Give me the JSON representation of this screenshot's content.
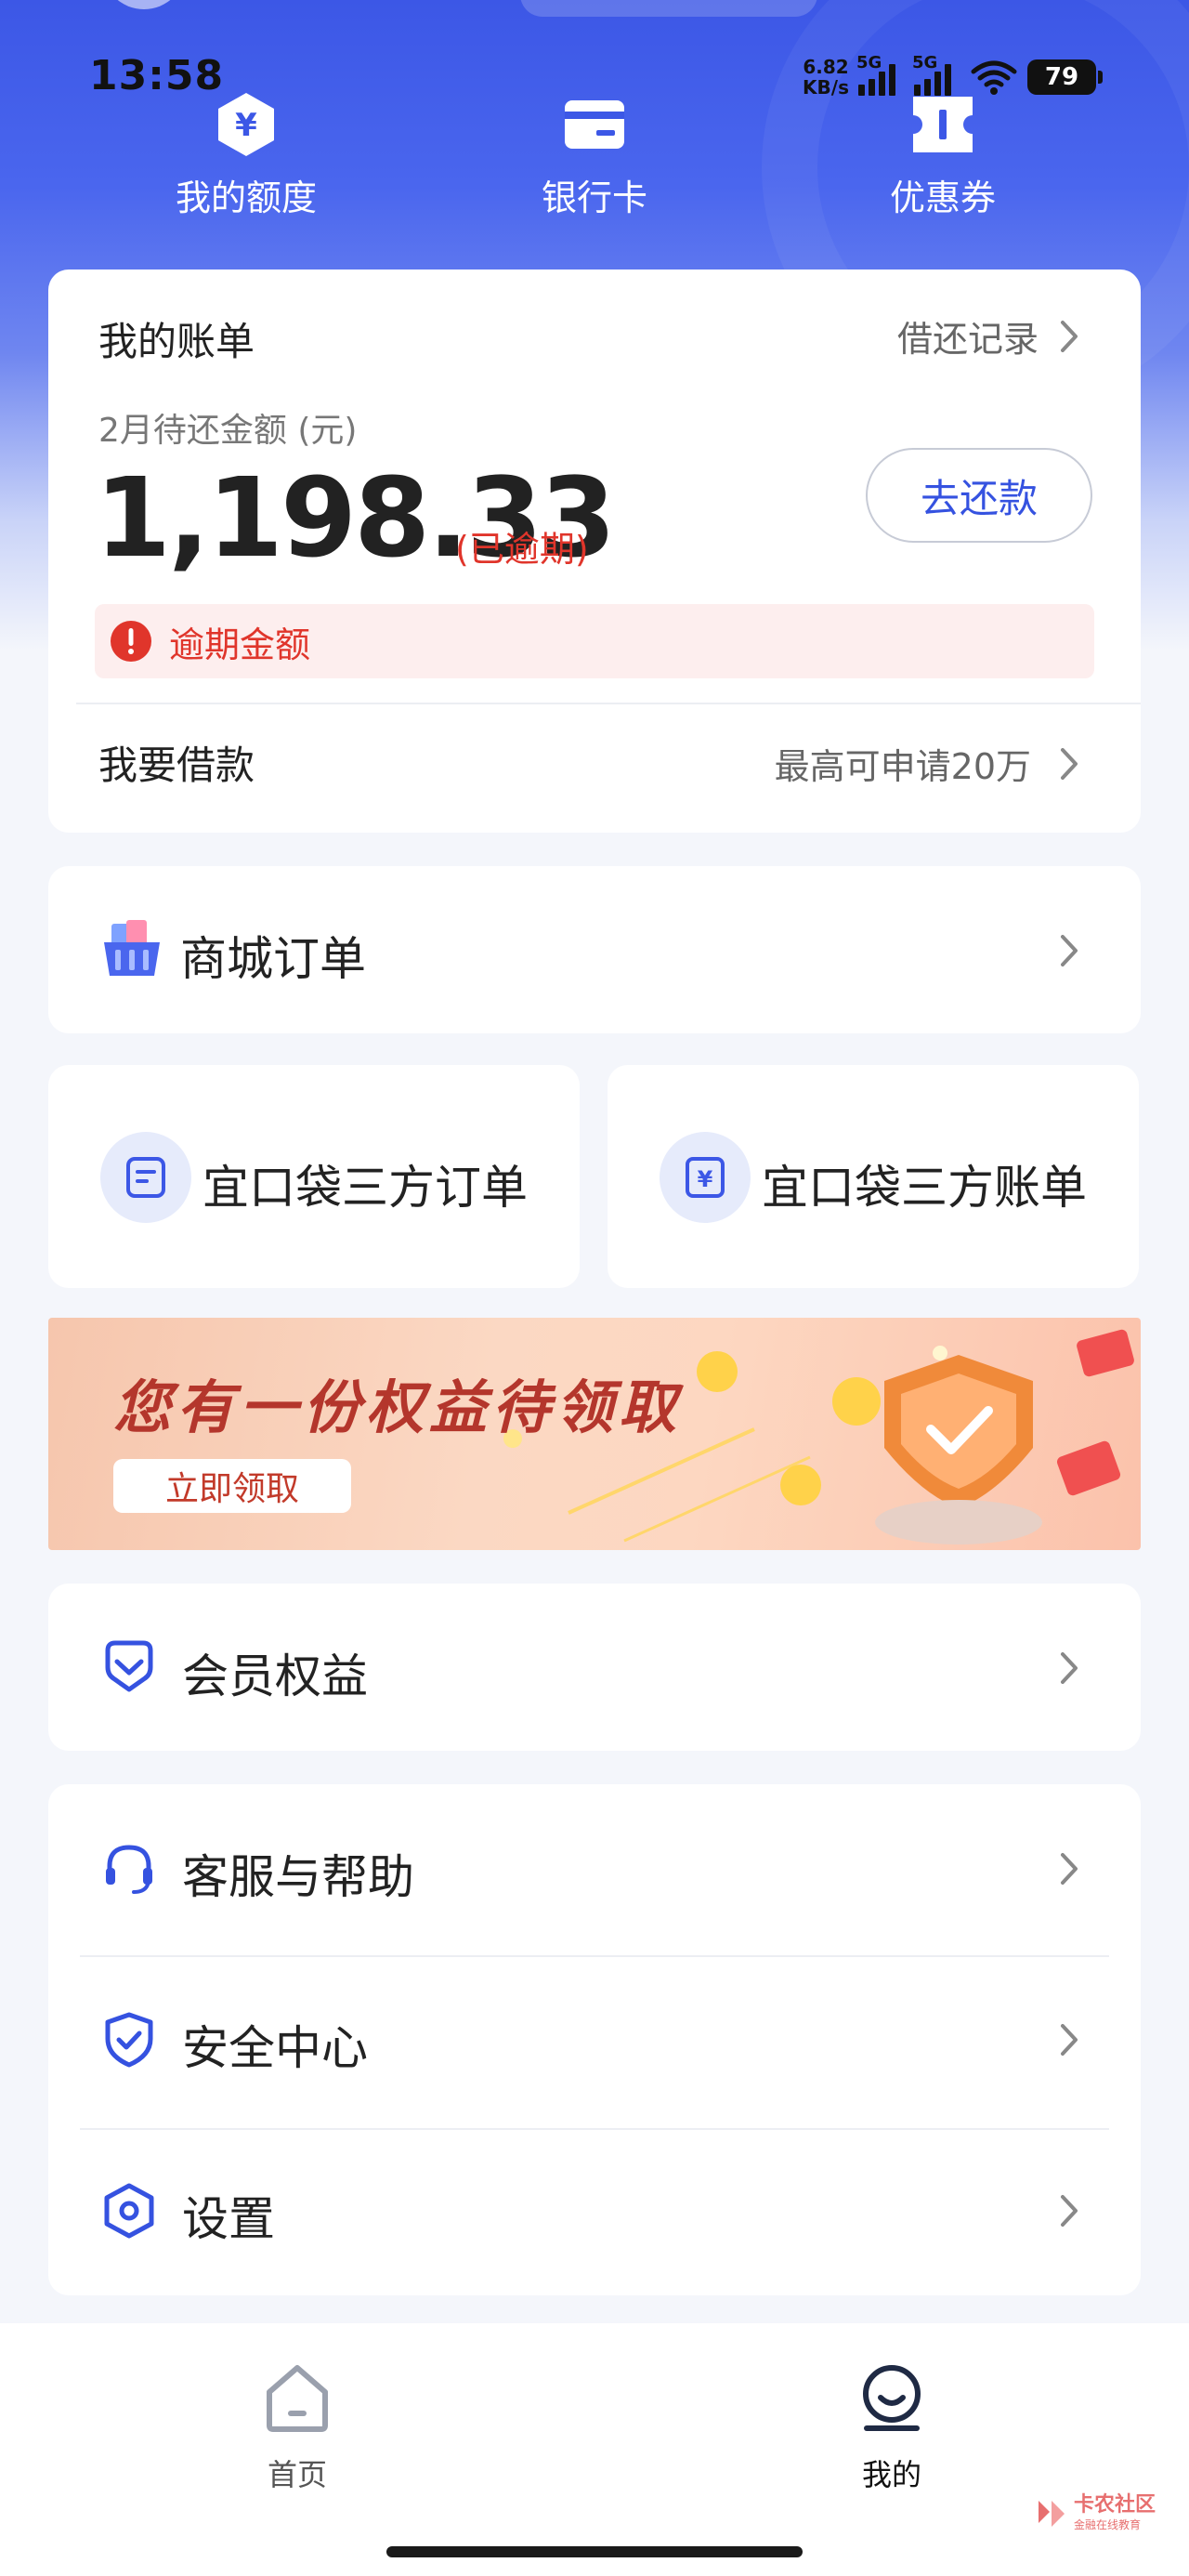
{
  "status_bar": {
    "time": "13:58",
    "net_speed_value": "6.82",
    "net_speed_unit": "KB/s",
    "sim1_tag": "5G",
    "sim2_tag": "5G",
    "battery": "79"
  },
  "quick_nav": [
    {
      "label": "我的额度",
      "icon": "yuan-hexagon-icon"
    },
    {
      "label": "银行卡",
      "icon": "bank-card-icon"
    },
    {
      "label": "优惠券",
      "icon": "coupon-icon"
    }
  ],
  "bill": {
    "title": "我的账单",
    "record_link": "借还记录",
    "subtitle": "2月待还金额 (元)",
    "amount": "1,198.33",
    "overdue_tag": "(已逾期)",
    "repay_button": "去还款",
    "overdue_notice": "逾期金额",
    "borrow_label": "我要借款",
    "borrow_hint": "最高可申请20万"
  },
  "mall_orders": {
    "label": "商城订单"
  },
  "third_party": [
    {
      "label": "宜口袋三方订单",
      "icon": "document-icon"
    },
    {
      "label": "宜口袋三方账单",
      "icon": "yuan-bill-icon"
    }
  ],
  "banner": {
    "title": "您有一份权益待领取",
    "button": "立即领取"
  },
  "member_benefits": {
    "label": "会员权益"
  },
  "service_list": [
    {
      "label": "客服与帮助",
      "icon": "headset-icon"
    },
    {
      "label": "安全中心",
      "icon": "shield-check-icon"
    },
    {
      "label": "设置",
      "icon": "settings-hexagon-icon"
    }
  ],
  "bottom_nav": [
    {
      "label": "首页",
      "icon": "home-icon",
      "active": false
    },
    {
      "label": "我的",
      "icon": "profile-icon",
      "active": true
    }
  ],
  "watermark": {
    "title": "卡农社区",
    "subtitle": "金融在线教育"
  },
  "colors": {
    "primary": "#3552e0",
    "hero": "#3c57e6",
    "danger": "#e0352b",
    "page_bg": "#f4f6fb",
    "nav_inactive": "#9aa0ad",
    "nav_active": "#1f2a44"
  }
}
